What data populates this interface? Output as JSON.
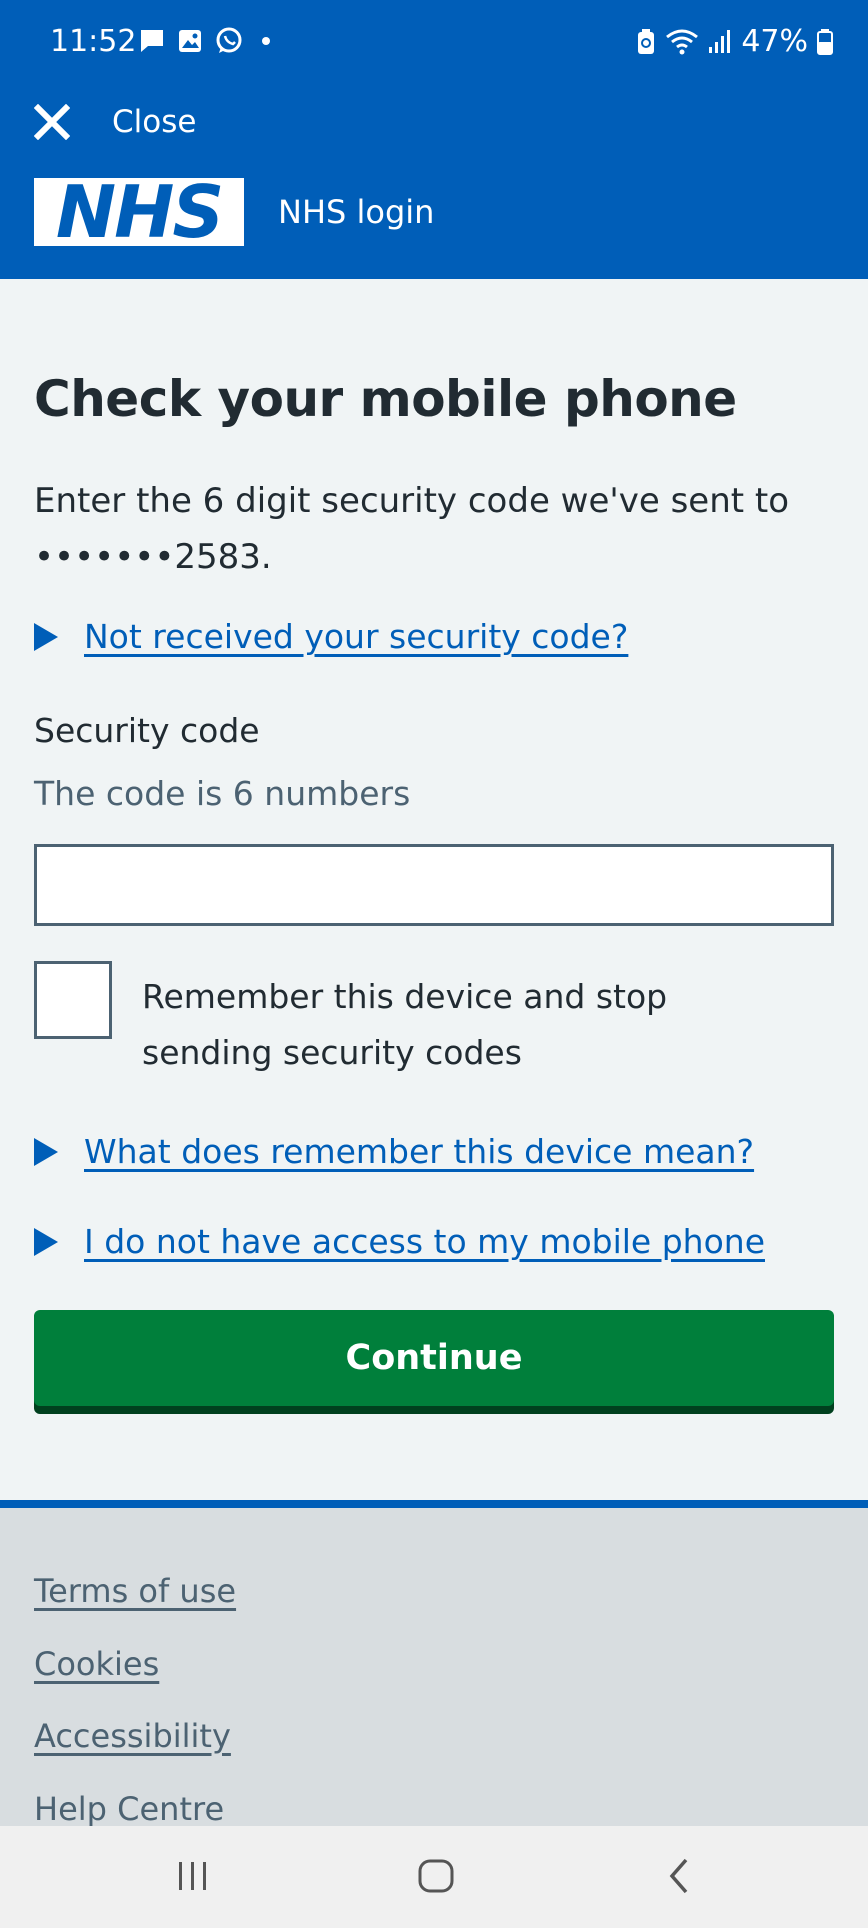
{
  "status_bar": {
    "time": "11:52",
    "battery": "47%",
    "icons": [
      "message-icon",
      "gallery-icon",
      "whatsapp-icon",
      "dot-icon",
      "battery-saver-icon",
      "wifi-icon",
      "signal-icon",
      "battery-icon"
    ]
  },
  "header": {
    "close_label": "Close",
    "logo_text": "NHS",
    "service_name": "NHS login",
    "color": "#005eb8"
  },
  "main": {
    "title": "Check your mobile phone",
    "intro": "Enter the 6 digit security code we've sent to •••••••2583.",
    "not_received_link": "Not received your security code?",
    "field_label": "Security code",
    "field_hint": "The code is 6 numbers",
    "field_value": "",
    "remember_label": "Remember this device and stop sending security codes",
    "remember_checked": false,
    "remember_meaning_link": "What does remember this device mean?",
    "no_access_link": "I do not have access to my mobile phone",
    "continue_label": "Continue",
    "button_color": "#007f3b"
  },
  "footer": {
    "links": [
      "Terms of use",
      "Cookies",
      "Accessibility",
      "Help Centre"
    ]
  },
  "navbar": {
    "icons": [
      "recent-apps-icon",
      "home-icon",
      "back-icon"
    ]
  }
}
